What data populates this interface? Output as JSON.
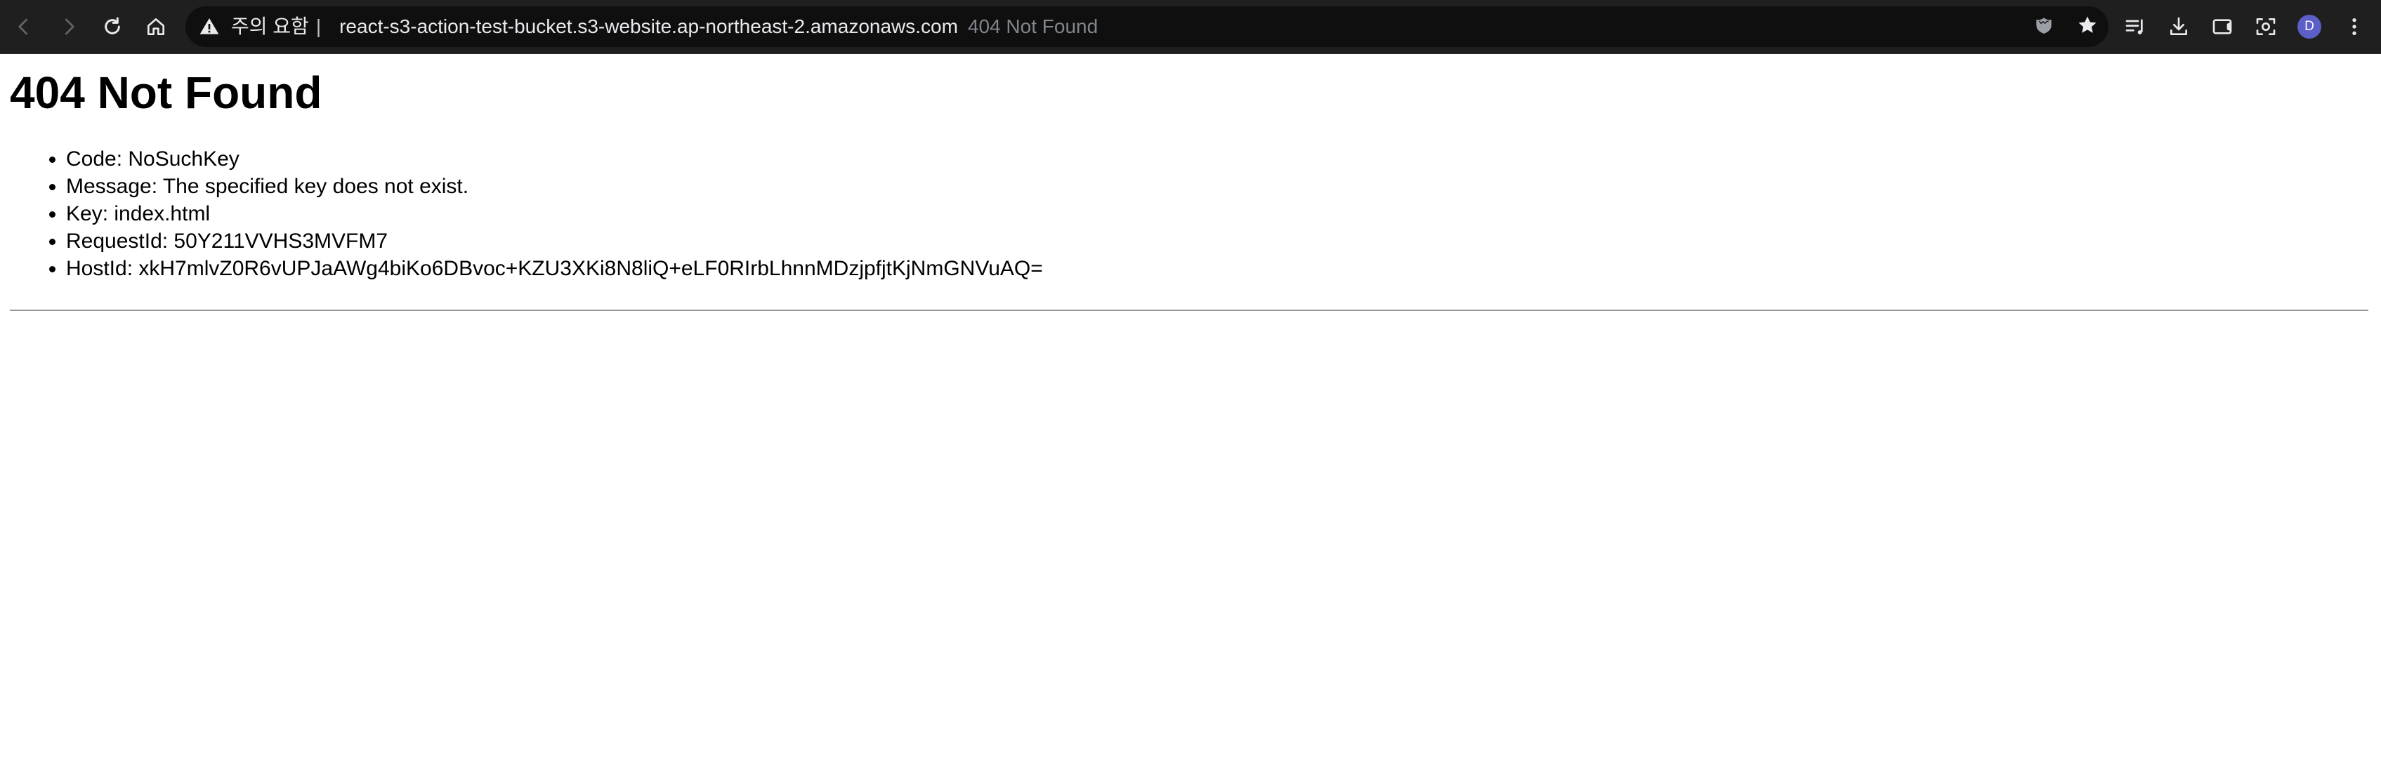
{
  "browser": {
    "security_warning": "주의 요함",
    "separator": "|",
    "url": "react-s3-action-test-bucket.s3-website.ap-northeast-2.amazonaws.com",
    "page_title": "404 Not Found",
    "profile_initial": "D",
    "icons": {
      "back": "arrow-left-icon",
      "forward": "arrow-right-icon",
      "reload": "reload-icon",
      "home": "home-icon",
      "warning": "warning-triangle-icon",
      "shield": "shield-icon",
      "bookmark": "star-icon",
      "reading_list": "reading-list-icon",
      "downloads": "download-icon",
      "cast": "cast-icon",
      "screenshot": "screenshot-icon",
      "menu": "kebab-menu-icon"
    }
  },
  "page": {
    "heading": "404 Not Found",
    "details": [
      "Code: NoSuchKey",
      "Message: The specified key does not exist.",
      "Key: index.html",
      "RequestId: 50Y211VVHS3MVFM7",
      "HostId: xkH7mlvZ0R6vUPJaAWg4biKo6DBvoc+KZU3XKi8N8liQ+eLF0RIrbLhnnMDzjpfjtKjNmGNVuAQ="
    ]
  },
  "colors": {
    "toolbar_bg": "#1f1f1f",
    "omnibox_bg": "#0f0f0f",
    "avatar_bg": "#5b5fc7",
    "page_bg": "#ffffff"
  }
}
